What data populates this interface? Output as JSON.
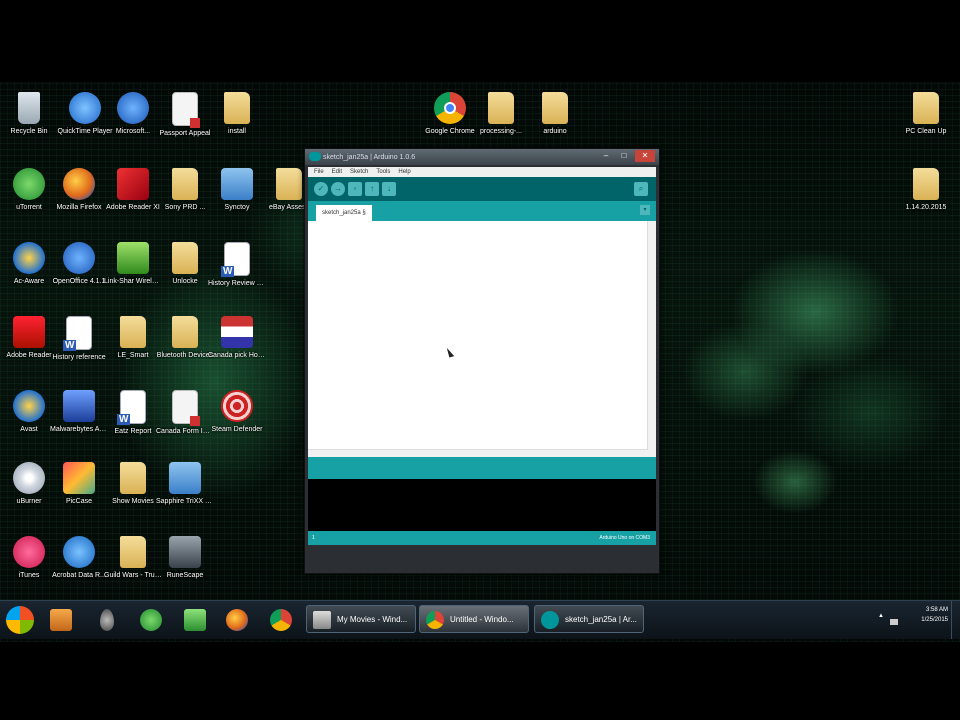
{
  "desktop": {
    "icons": [
      {
        "label": "Recycle Bin",
        "name": "recycle-bin-icon",
        "kind": "bin"
      },
      {
        "label": "QuickTime Player",
        "name": "quicktime-icon",
        "kind": "qt"
      },
      {
        "label": "Microsoft...",
        "name": "microsoft-icon",
        "kind": "blue"
      },
      {
        "label": "Passport Appeal",
        "name": "passport-appeal-icon",
        "kind": "doc"
      },
      {
        "label": "install",
        "name": "install-folder-icon",
        "kind": "folder"
      },
      {
        "label": "Google Chrome",
        "name": "google-chrome-icon",
        "kind": "chrome"
      },
      {
        "label": "processing-...",
        "name": "processing-folder-icon",
        "kind": "folder"
      },
      {
        "label": "arduino",
        "name": "arduino-folder-icon",
        "kind": "folder"
      },
      {
        "label": "PC Clean Up",
        "name": "pc-clean-up-folder-icon",
        "kind": "folder"
      },
      {
        "label": "uTorrent",
        "name": "utorrent-icon",
        "kind": "utor"
      },
      {
        "label": "Mozilla Firefox",
        "name": "firefox-icon",
        "kind": "fox"
      },
      {
        "label": "Adobe Reader XI",
        "name": "adobe-reader-xi-icon",
        "kind": "red"
      },
      {
        "label": "Sony PRD ...",
        "name": "sony-prd-folder-icon",
        "kind": "folder"
      },
      {
        "label": "Synctoy",
        "name": "synctoy-icon",
        "kind": "sync"
      },
      {
        "label": "eBay Assess",
        "name": "ebay-assess-folder-icon",
        "kind": "folder"
      },
      {
        "label": "1.14.20.2015",
        "name": "dated-folder-icon",
        "kind": "folder"
      },
      {
        "label": "Ac-Aware",
        "name": "ad-aware-icon",
        "kind": "av"
      },
      {
        "label": "OpenOffice 4.1.1",
        "name": "openoffice-icon",
        "kind": "blue"
      },
      {
        "label": "Link-Shar Wireless",
        "name": "wireless-icon",
        "kind": "green"
      },
      {
        "label": "Unlocke",
        "name": "unlocke-folder-icon",
        "kind": "folder"
      },
      {
        "label": "History Review Sheet",
        "name": "history-review-icon",
        "kind": "word"
      },
      {
        "label": "Adobe Reader",
        "name": "adobe-reader-icon",
        "kind": "pdf"
      },
      {
        "label": "History reference",
        "name": "history-reference-icon",
        "kind": "word"
      },
      {
        "label": "LE_Smart",
        "name": "le-smart-folder-icon",
        "kind": "folder"
      },
      {
        "label": "Bluetooth Devices",
        "name": "bluetooth-devices-folder-icon",
        "kind": "folder"
      },
      {
        "label": "Canada pick Hockey Tea",
        "name": "canada-pick-icon",
        "kind": "flag"
      },
      {
        "label": "Avast",
        "name": "avast-icon",
        "kind": "av"
      },
      {
        "label": "Malwarebytes Anti-Malware",
        "name": "malwarebytes-icon",
        "kind": "malw"
      },
      {
        "label": "Eatz Report",
        "name": "eatz-report-icon",
        "kind": "word"
      },
      {
        "label": "Canada Form INSTRUCTIO...",
        "name": "canada-form-icon",
        "kind": "doc"
      },
      {
        "label": "Steam Defender",
        "name": "steam-defender-icon",
        "kind": "target"
      },
      {
        "label": "uBurner",
        "name": "uburner-icon",
        "kind": "cd"
      },
      {
        "label": "PicCase",
        "name": "piccase-icon",
        "kind": "pic"
      },
      {
        "label": "Show Movies",
        "name": "show-movies-folder-icon",
        "kind": "folder"
      },
      {
        "label": "Sapphire TriXX Tool Center",
        "name": "sapphire-trixx-icon",
        "kind": "sync"
      },
      {
        "label": "iTunes",
        "name": "itunes-icon",
        "kind": "itunes"
      },
      {
        "label": "Acrobat Data R...",
        "name": "acrobat-data-icon",
        "kind": "plus"
      },
      {
        "label": "Guild Wars - True Online",
        "name": "guild-wars-folder-icon",
        "kind": "folder"
      },
      {
        "label": "RuneScape",
        "name": "runescape-icon",
        "kind": "rune"
      }
    ]
  },
  "ide": {
    "title": "sketch_jan25a | Arduino 1.0.6",
    "menu": [
      "File",
      "Edit",
      "Sketch",
      "Tools",
      "Help"
    ],
    "toolbar": {
      "verify": "✓",
      "upload": "→",
      "new": "▫",
      "open": "↑",
      "save": "↓",
      "serial_monitor": "⌕"
    },
    "tab_label": "sketch_jan25a §",
    "tab_menu": "▾",
    "line_number": "1",
    "board_port": "Arduino Uno on COM3",
    "window_controls": {
      "minimize": "–",
      "maximize": "□",
      "close": "✕"
    }
  },
  "taskbar": {
    "tasks": [
      {
        "label": "My Movies - Wind..."
      },
      {
        "label": "Untitled - Windo..."
      },
      {
        "label": "sketch_jan25a | Ar..."
      }
    ],
    "clock_time": "3:58 AM",
    "clock_date": "1/25/2015",
    "tray_arrow": "▲"
  }
}
